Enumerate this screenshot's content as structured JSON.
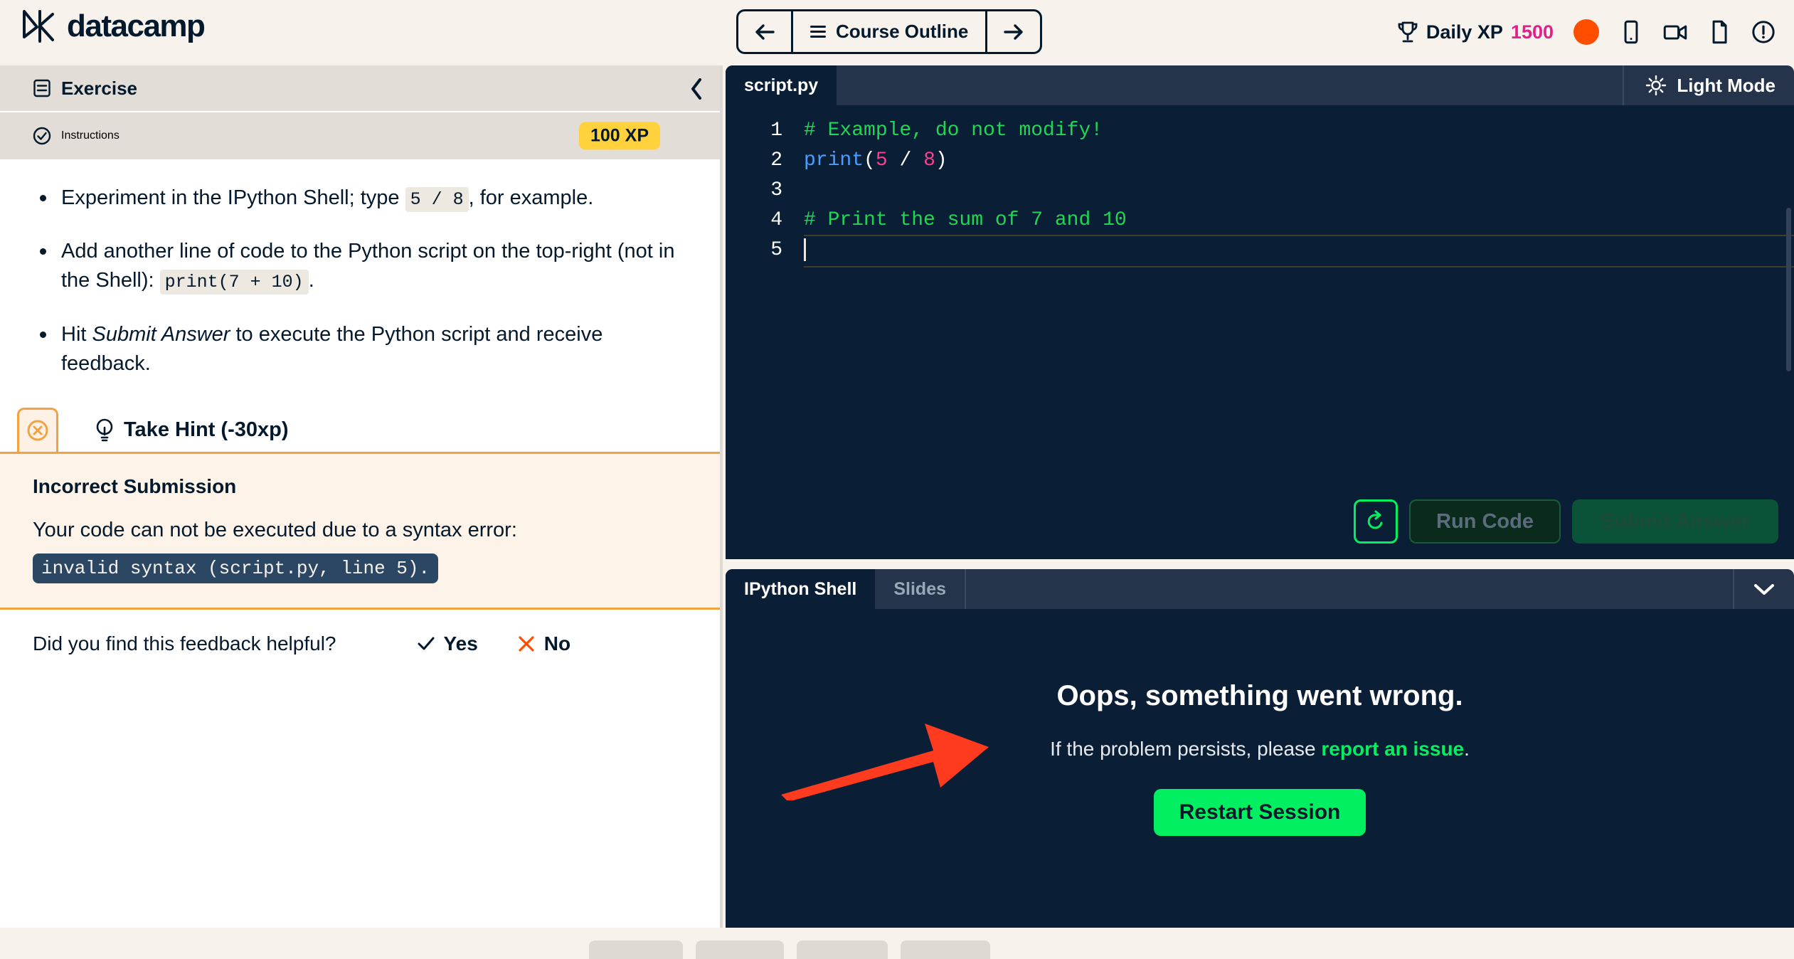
{
  "header": {
    "logo_text": "datacamp",
    "logo_icon": "datacamp-logo-icon",
    "nav": {
      "prev_icon": "arrow-left-icon",
      "outline_label": "Course Outline",
      "menu_icon": "hamburger-icon",
      "next_icon": "arrow-right-icon"
    },
    "daily_xp_label": "Daily XP",
    "daily_xp_value": "1500",
    "trophy_icon": "trophy-icon",
    "status_dot": "orange-status-dot",
    "icons": [
      "phone-icon",
      "video-camera-icon",
      "document-icon",
      "info-circle-icon"
    ],
    "accent_pink": "#E0218A",
    "accent_orange": "#FF4E00"
  },
  "left_panel": {
    "exercise_tab": "Exercise",
    "exercise_icon": "list-box-icon",
    "collapse_icon": "chevron-left-icon",
    "instructions_tab": "Instructions",
    "instructions_icon": "check-circle-icon",
    "xp_badge": "100 XP",
    "xp_badge_color": "#FFD13D",
    "instructions": [
      {
        "parts": [
          {
            "t": "text",
            "v": "Experiment in the IPython Shell; type "
          },
          {
            "t": "code",
            "v": "5 / 8"
          },
          {
            "t": "text",
            "v": ", for example."
          }
        ]
      },
      {
        "parts": [
          {
            "t": "text",
            "v": "Add another line of code to the Python script on the top-right (not in the Shell): "
          },
          {
            "t": "code",
            "v": "print(7 + 10)"
          },
          {
            "t": "text",
            "v": "."
          }
        ]
      },
      {
        "parts": [
          {
            "t": "text",
            "v": "Hit "
          },
          {
            "t": "em",
            "v": "Submit Answer"
          },
          {
            "t": "text",
            "v": " to execute the Python script and receive feedback."
          }
        ]
      }
    ],
    "hint": {
      "status_icon": "circle-x-icon",
      "bulb_icon": "lightbulb-icon",
      "label": "Take Hint (-30xp)",
      "accent": "#F2A341"
    },
    "feedback": {
      "title": "Incorrect Submission",
      "message": "Your code can not be executed due to a syntax error:",
      "code": "invalid syntax (script.py, line 5).",
      "helpful_question": "Did you find this feedback helpful?",
      "yes_label": "Yes",
      "yes_icon": "check-icon",
      "no_label": "No",
      "no_icon": "x-icon"
    }
  },
  "editor": {
    "tab_label": "script.py",
    "light_mode_label": "Light Mode",
    "light_mode_icon": "sun-icon",
    "lines": [
      {
        "n": "1",
        "tokens": [
          {
            "c": "c-com",
            "v": "# Example, do not modify!"
          }
        ]
      },
      {
        "n": "2",
        "tokens": [
          {
            "c": "c-fn",
            "v": "print"
          },
          {
            "c": "c-pl",
            "v": "("
          },
          {
            "c": "c-num",
            "v": "5"
          },
          {
            "c": "c-pl",
            "v": " / "
          },
          {
            "c": "c-num",
            "v": "8"
          },
          {
            "c": "c-pl",
            "v": ")"
          }
        ]
      },
      {
        "n": "3",
        "tokens": []
      },
      {
        "n": "4",
        "tokens": [
          {
            "c": "c-com",
            "v": "# Print the sum of 7 and 10"
          }
        ]
      },
      {
        "n": "5",
        "tokens": [],
        "active": true,
        "caret": true
      }
    ],
    "reset_icon": "reset-arrow-icon",
    "run_label": "Run Code",
    "submit_label": "Submit Answer"
  },
  "shell": {
    "tab_active": "IPython Shell",
    "tab_inactive": "Slides",
    "chevron_icon": "chevron-down-icon",
    "error_title": "Oops, something went wrong.",
    "error_prefix": "If the problem persists, please ",
    "error_link": "report an issue",
    "error_suffix": ".",
    "restart_label": "Restart Session",
    "restart_color": "#03EF62"
  },
  "annotation": {
    "arrow_icon": "red-pointer-arrow",
    "color": "#FF3B1F"
  }
}
